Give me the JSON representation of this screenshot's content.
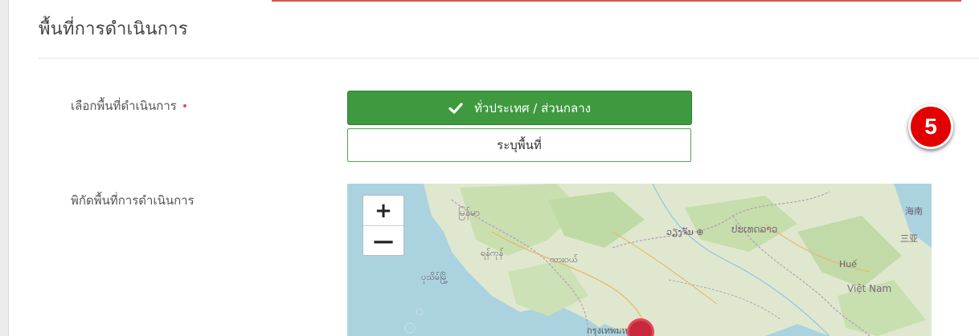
{
  "section": {
    "title": "พื้นที่การดำเนินการ"
  },
  "fields": {
    "area_label": "เลือกพื้นที่ดำเนินการ",
    "required_mark": "•",
    "coord_label": "พิกัดพื้นที่การดำเนินการ"
  },
  "area_options": {
    "nationwide": "ทั่วประเทศ / ส่วนกลาง",
    "specify": "ระบุพื้นที่"
  },
  "badge": {
    "number": "5"
  },
  "map": {
    "zoom_in": "+",
    "zoom_out": "—",
    "labels": {
      "myanmar": "မြန်မာ",
      "laos": "ປະເທດລາວ",
      "vientiane_area": "ວຽງຈັນ ⊕",
      "ayeyarwady": "ရန်ကုန်",
      "bago": "ပုသိမ်မြို့",
      "mawlamyine": "ထားဝယ်",
      "hue": "Huế",
      "vietnam": "Việt Nam",
      "hainan": "海南",
      "sanya": "三亚",
      "bangkok": "กรุงเทพมหานคร"
    }
  },
  "colors": {
    "accent_green": "#3f9a3f",
    "badge_red": "#e20000",
    "required_red": "#d9534f"
  }
}
